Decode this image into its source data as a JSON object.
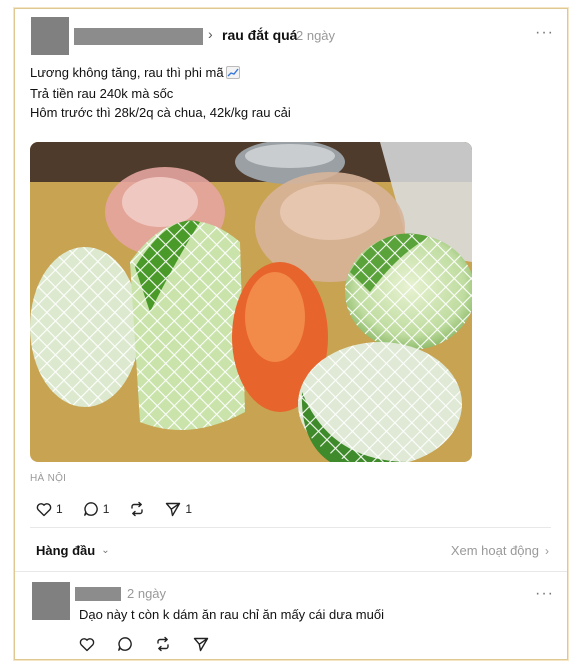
{
  "post": {
    "topic": "rau đắt quá",
    "time": "2 ngày",
    "text_lines": [
      "Lương không tăng, rau thì phi mã",
      "Trả tiền rau 240k mà sốc",
      "Hôm trước thì 28k/2q cà chua, 42k/kg rau cải"
    ],
    "trend_icon": "chart-increasing-icon",
    "location": "HÀ NỘI",
    "likes": "1",
    "comments": "1",
    "shares": "1"
  },
  "replies_bar": {
    "sort_label": "Hàng đầu",
    "activity_label": "Xem hoạt động"
  },
  "reply": {
    "time": "2 ngày",
    "text": "Dạo này t còn k dám ăn rau chỉ ăn mấy cái dưa muối"
  },
  "colors": {
    "frame_border": "#e0c893",
    "redaction": "#808080",
    "muted_text": "#999999"
  }
}
